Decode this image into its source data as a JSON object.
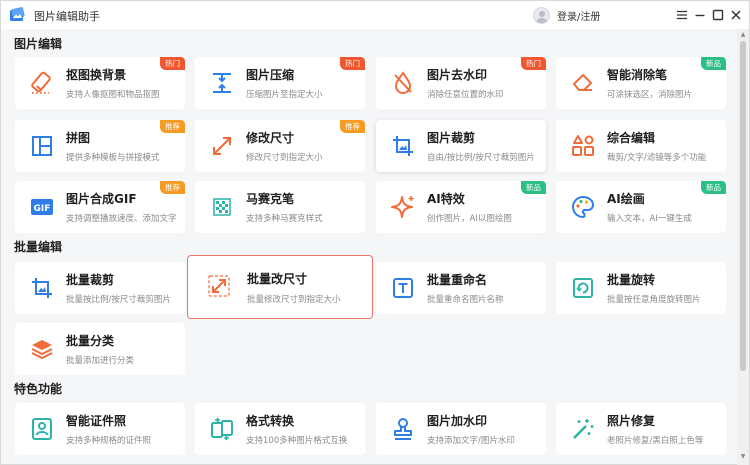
{
  "app": {
    "title": "图片编辑助手",
    "login_label": "登录/注册"
  },
  "colors": {
    "accent": "#f2562e",
    "hot": "#f2562e",
    "recommend": "#f59a23",
    "new": "#2bbf86",
    "icon_orange": "#f26b3a",
    "icon_blue": "#2f7ee8",
    "selected_border": "#e8776a"
  },
  "sections": {
    "edit": {
      "title": "图片编辑"
    },
    "batch": {
      "title": "批量编辑"
    },
    "special": {
      "title": "特色功能"
    }
  },
  "cards": {
    "cutout": {
      "title": "抠图换背景",
      "desc": "支持人像抠图和物品抠图",
      "badge": "热门",
      "icon": "eraser-icon"
    },
    "compress": {
      "title": "图片压缩",
      "desc": "压缩图片至指定大小",
      "badge": "热门",
      "icon": "compress-icon"
    },
    "watermark_remove": {
      "title": "图片去水印",
      "desc": "消除任意位置的水印",
      "badge": "热门",
      "icon": "drop-icon"
    },
    "smart_erase": {
      "title": "智能消除笔",
      "desc": "可涂抹选区，消除图片",
      "badge": "新品",
      "icon": "eraser-pen-icon"
    },
    "collage": {
      "title": "拼图",
      "desc": "提供多种模板与拼接模式",
      "badge": "推荐",
      "icon": "grid-icon"
    },
    "resize": {
      "title": "修改尺寸",
      "desc": "修改尺寸到指定大小",
      "badge": "推荐",
      "icon": "resize-icon"
    },
    "crop": {
      "title": "图片裁剪",
      "desc": "自由/按比例/按尺寸裁剪图片",
      "icon": "crop-icon"
    },
    "comprehensive": {
      "title": "综合编辑",
      "desc": "裁剪/文字/滤镜等多个功能",
      "icon": "shapes-icon"
    },
    "gif": {
      "title": "图片合成GIF",
      "desc": "支持调整播放速度、添加文字",
      "badge": "推荐",
      "icon": "gif-icon"
    },
    "mosaic": {
      "title": "马赛克笔",
      "desc": "支持多种马赛克样式",
      "icon": "mosaic-icon"
    },
    "ai_effect": {
      "title": "AI特效",
      "desc": "创作图片，AI以图绘图",
      "badge": "新品",
      "icon": "sparkle-icon"
    },
    "ai_paint": {
      "title": "AI绘画",
      "desc": "输入文本，AI一键生成",
      "badge": "新品",
      "icon": "palette-icon"
    },
    "batch_crop": {
      "title": "批量裁剪",
      "desc": "批量按比例/按尺寸裁剪图片",
      "icon": "crop-icon"
    },
    "batch_resize": {
      "title": "批量改尺寸",
      "desc": "批量修改尺寸到指定大小",
      "icon": "resize-icon"
    },
    "batch_rename": {
      "title": "批量重命名",
      "desc": "批量重命名图片名称",
      "icon": "text-icon"
    },
    "batch_rotate": {
      "title": "批量旋转",
      "desc": "批量按任意角度旋转图片",
      "icon": "rotate-icon"
    },
    "batch_classify": {
      "title": "批量分类",
      "desc": "批量添加进行分类",
      "icon": "layers-icon"
    },
    "id_photo": {
      "title": "智能证件照",
      "desc": "支持多种规格的证件照",
      "icon": "id-photo-icon"
    },
    "format": {
      "title": "格式转换",
      "desc": "支持100多种图片格式互换",
      "icon": "convert-icon"
    },
    "add_watermark": {
      "title": "图片加水印",
      "desc": "支持添加文字/图片水印",
      "icon": "stamp-icon"
    },
    "repair": {
      "title": "照片修复",
      "desc": "老照片修复/黑白照上色等",
      "icon": "magic-wand-icon"
    }
  }
}
